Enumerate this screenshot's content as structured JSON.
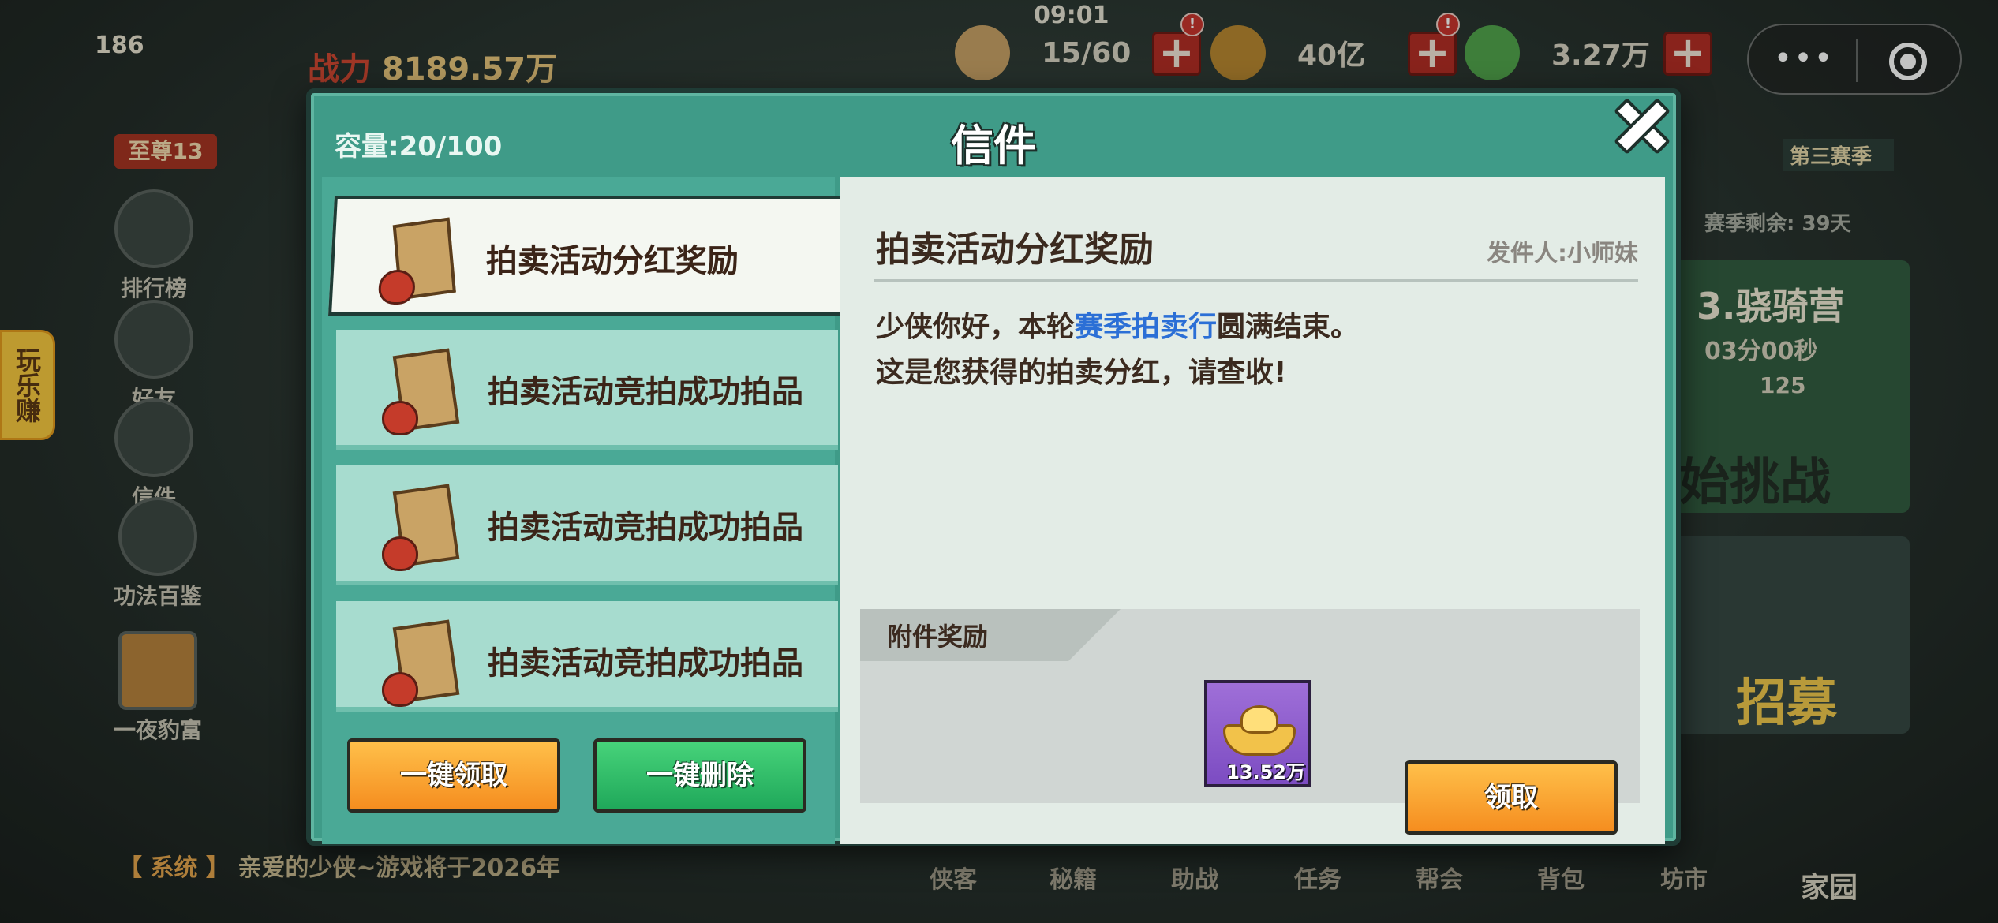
{
  "hud": {
    "clock": "09:01",
    "level": "186",
    "power_prefix": "战力",
    "power": "8189.57万",
    "rank": "至尊13",
    "stamina": "15/60",
    "coins": "40亿",
    "jade": "3.27万",
    "plus": "+",
    "more_icon": "•••"
  },
  "left_menu": [
    {
      "label": "排行榜"
    },
    {
      "label": "好友"
    },
    {
      "label": "信件"
    },
    {
      "label": "功法百鉴"
    },
    {
      "label": "一夜豹富"
    }
  ],
  "earn_tab": "玩乐赚",
  "system_bar": {
    "tag": "【 系统 】",
    "message": "亲爱的少侠~游戏将于2026年"
  },
  "bottom_nav": [
    "侠客",
    "秘籍",
    "助战",
    "任务",
    "帮会",
    "背包",
    "坊市",
    "家园"
  ],
  "right_side": {
    "season": "第三赛季",
    "season_remaining": "赛季剩余: 39天",
    "event": "3.骁骑营",
    "timer": "03分00秒",
    "count": "125",
    "challenge": "始挑战",
    "recruit": "招募"
  },
  "mail_dialog": {
    "title": "信件",
    "capacity": "容量:20/100",
    "items": [
      {
        "title": "拍卖活动分红奖励",
        "selected": true
      },
      {
        "title": "拍卖活动竞拍成功拍品",
        "selected": false
      },
      {
        "title": "拍卖活动竞拍成功拍品",
        "selected": false
      },
      {
        "title": "拍卖活动竞拍成功拍品",
        "selected": false
      }
    ],
    "claim_all_label": "一键领取",
    "delete_all_label": "一键删除",
    "detail": {
      "title": "拍卖活动分红奖励",
      "sender_label": "发件人:",
      "sender_name": "小师妹",
      "line1_pre": "少侠你好，本轮",
      "line1_highlight": "赛季拍卖行",
      "line1_post": "圆满结束。",
      "line2": "这是您获得的拍卖分红，请查收!",
      "attachment_label": "附件奖励",
      "reward_qty": "13.52万",
      "reward_icon": "gold-ingot-icon",
      "claim_label": "领取"
    }
  }
}
